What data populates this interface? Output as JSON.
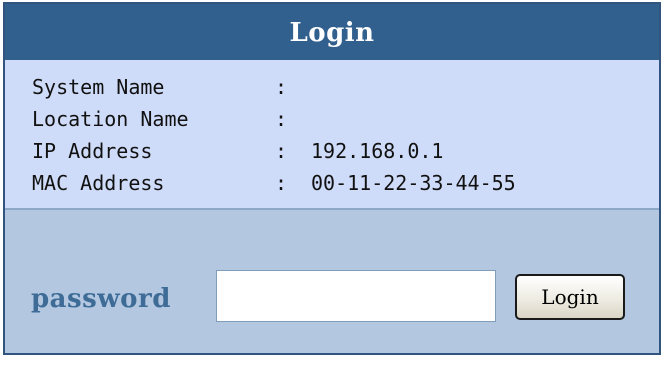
{
  "title": "Login",
  "system_info": [
    {
      "label": "System Name",
      "value": ""
    },
    {
      "label": "Location Name",
      "value": ""
    },
    {
      "label": "IP Address",
      "value": "192.168.0.1"
    },
    {
      "label": "MAC Address",
      "value": "00-11-22-33-44-55"
    }
  ],
  "separator": ":",
  "password": {
    "label": "password",
    "value": "",
    "placeholder": ""
  },
  "login_button": "Login",
  "colors": {
    "title_bar": "#31608f",
    "info_background": "#cfdcf9",
    "form_background": "#b3c7e0",
    "border": "#32557f",
    "password_label": "#3e6c97"
  }
}
